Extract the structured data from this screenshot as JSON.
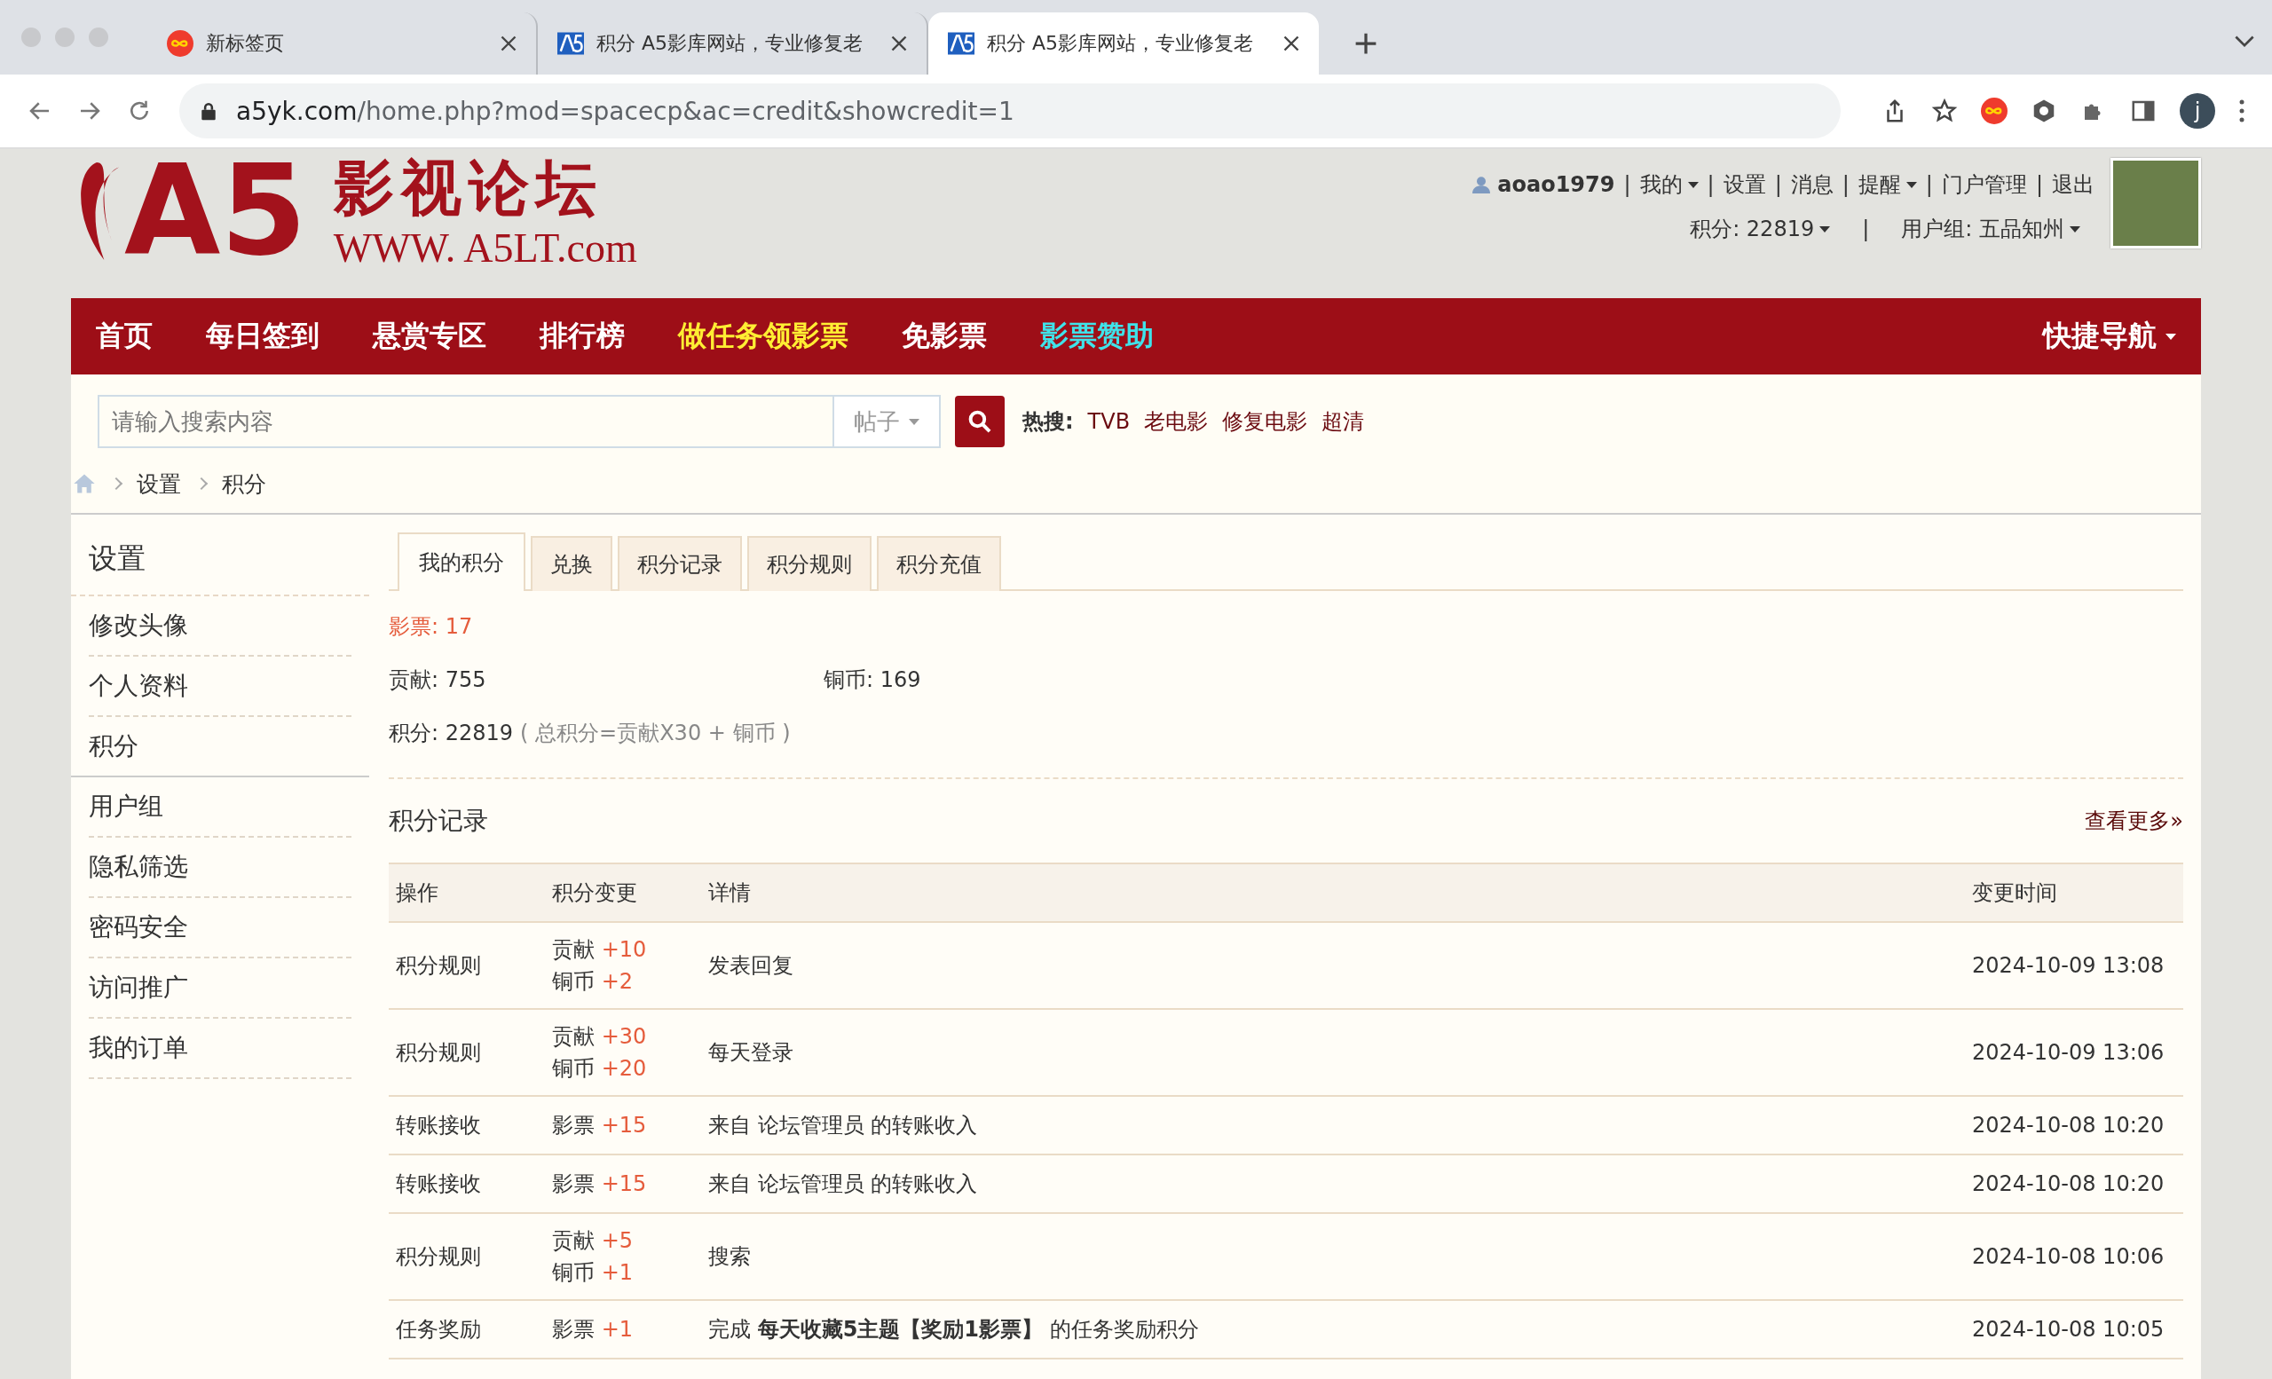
{
  "browser": {
    "tabs": [
      {
        "kind": "newtab",
        "title": "新标签页",
        "selected": false
      },
      {
        "kind": "site",
        "title": "积分 A5影库网站，专业修复老",
        "selected": false
      },
      {
        "kind": "site",
        "title": "积分 A5影库网站，专业修复老",
        "selected": true
      }
    ],
    "url_host": "a5yk.com",
    "url_path": "/home.php?mod=spacecp&ac=credit&showcredit=1",
    "profile_letter": "j"
  },
  "header": {
    "logo": {
      "mark": "A5",
      "title": "影视论坛",
      "url": "WWW. A5LT.com"
    },
    "user": {
      "name": "aoao1979",
      "links": [
        {
          "label": "我的",
          "dropdown": true
        },
        {
          "label": "设置",
          "dropdown": false
        },
        {
          "label": "消息",
          "dropdown": false
        },
        {
          "label": "提醒",
          "dropdown": true
        },
        {
          "label": "门户管理",
          "dropdown": false
        },
        {
          "label": "退出",
          "dropdown": false
        }
      ],
      "link_separator": "|",
      "credits": "积分: 22819",
      "separator": "|",
      "group": "用户组: 五品知州"
    }
  },
  "nav": {
    "items": [
      {
        "label": "首页",
        "color": "#ffffff"
      },
      {
        "label": "每日签到",
        "color": "#ffffff"
      },
      {
        "label": "悬赏专区",
        "color": "#ffffff"
      },
      {
        "label": "排行榜",
        "color": "#ffffff"
      },
      {
        "label": "做任务领影票",
        "color": "#ffee33"
      },
      {
        "label": "免影票",
        "color": "#ffffff"
      },
      {
        "label": "影票赞助",
        "color": "#3fe3ea"
      }
    ],
    "quick": "快捷导航"
  },
  "search": {
    "placeholder": "请输入搜索内容",
    "type": "帖子",
    "hot_label": "热搜:",
    "hot": [
      "TVB",
      "老电影",
      "修复电影",
      "超清"
    ]
  },
  "breadcrumb": [
    "设置",
    "积分"
  ],
  "sidebar": {
    "title": "设置",
    "items": [
      {
        "label": "修改头像",
        "selected": false
      },
      {
        "label": "个人资料",
        "selected": false
      },
      {
        "label": "积分",
        "selected": true
      },
      {
        "label": "用户组",
        "selected": false
      },
      {
        "label": "隐私筛选",
        "selected": false
      },
      {
        "label": "密码安全",
        "selected": false
      },
      {
        "label": "访问推广",
        "selected": false
      },
      {
        "label": "我的订单",
        "selected": false
      }
    ]
  },
  "tabs": [
    {
      "label": "我的积分",
      "selected": true
    },
    {
      "label": "兑换",
      "selected": false
    },
    {
      "label": "积分记录",
      "selected": false
    },
    {
      "label": "积分规则",
      "selected": false
    },
    {
      "label": "积分充值",
      "selected": false
    }
  ],
  "summary": {
    "tickets": "影票: 17",
    "contribution": "贡献: 755",
    "copper": "铜币: 169",
    "total": "积分: 22819",
    "formula": "( 总积分=贡献X30 + 铜币 )"
  },
  "records": {
    "title": "积分记录",
    "more": "查看更多»",
    "columns": [
      "操作",
      "积分变更",
      "详情",
      "变更时间"
    ],
    "rows": [
      {
        "action": "积分规则",
        "changes": [
          {
            "label": "贡献",
            "delta": "+10"
          },
          {
            "label": "铜币",
            "delta": "+2"
          }
        ],
        "detail": "发表回复",
        "time": "2024-10-09 13:08"
      },
      {
        "action": "积分规则",
        "changes": [
          {
            "label": "贡献",
            "delta": "+30"
          },
          {
            "label": "铜币",
            "delta": "+20"
          }
        ],
        "detail": "每天登录",
        "time": "2024-10-09 13:06"
      },
      {
        "action": "转账接收",
        "changes": [
          {
            "label": "影票",
            "delta": "+15"
          }
        ],
        "detail": "来自 论坛管理员 的转账收入",
        "time": "2024-10-08 10:20"
      },
      {
        "action": "转账接收",
        "changes": [
          {
            "label": "影票",
            "delta": "+15"
          }
        ],
        "detail": "来自 论坛管理员 的转账收入",
        "time": "2024-10-08 10:20"
      },
      {
        "action": "积分规则",
        "changes": [
          {
            "label": "贡献",
            "delta": "+5"
          },
          {
            "label": "铜币",
            "delta": "+1"
          }
        ],
        "detail": "搜索",
        "time": "2024-10-08 10:06"
      },
      {
        "action": "任务奖励",
        "changes": [
          {
            "label": "影票",
            "delta": "+1"
          }
        ],
        "detail": "完成 **每天收藏5主题【奖励1影票】** 的任务奖励积分",
        "time": "2024-10-08 10:05"
      }
    ]
  }
}
